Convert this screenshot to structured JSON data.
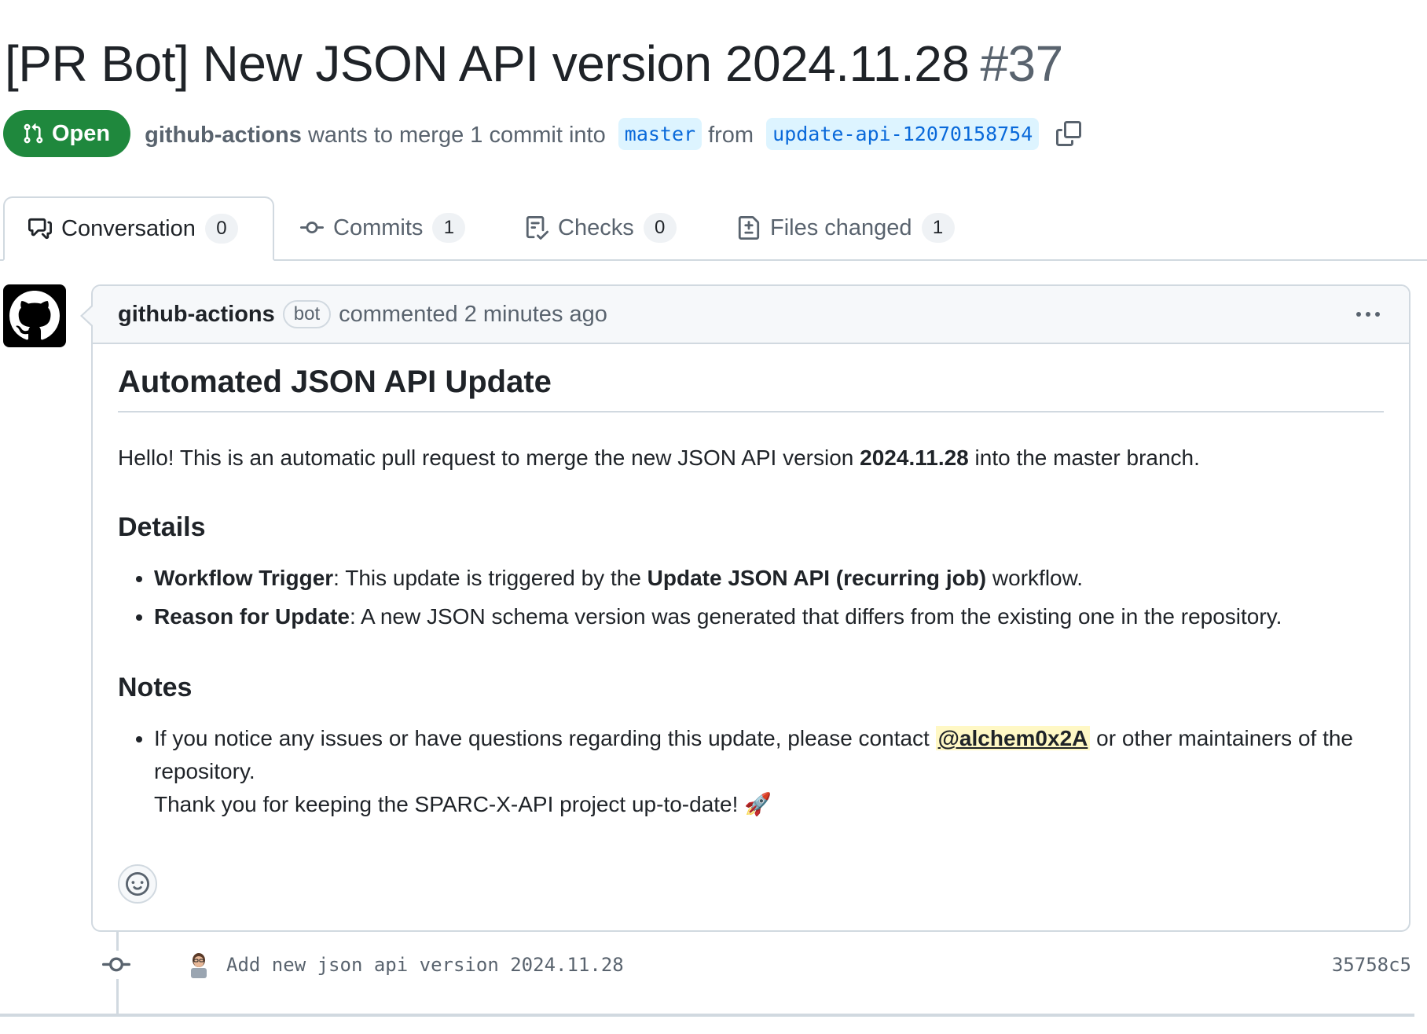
{
  "pr": {
    "title": "[PR Bot] New JSON API version 2024.11.28",
    "number": "#37",
    "state": "Open",
    "author": "github-actions",
    "merge_text": "wants to merge 1 commit into",
    "base_branch": "master",
    "from_text": "from",
    "head_branch": "update-api-12070158754"
  },
  "tabs": [
    {
      "label": "Conversation",
      "count": "0",
      "icon": "comment-discussion-icon"
    },
    {
      "label": "Commits",
      "count": "1",
      "icon": "git-commit-icon"
    },
    {
      "label": "Checks",
      "count": "0",
      "icon": "checklist-icon"
    },
    {
      "label": "Files changed",
      "count": "1",
      "icon": "file-diff-icon"
    }
  ],
  "comment": {
    "author": "github-actions",
    "badge": "bot",
    "meta": "commented 2 minutes ago",
    "heading": "Automated JSON API Update",
    "intro_pre": "Hello! This is an automatic pull request to merge the new JSON API version ",
    "intro_version": "2024.11.28",
    "intro_post": " into the master branch.",
    "details_heading": "Details",
    "details": [
      {
        "term": "Workflow Trigger",
        "pre": ": This update is triggered by the ",
        "strong": "Update JSON API (recurring job)",
        "post": " workflow."
      },
      {
        "term": "Reason for Update",
        "pre": ": A new JSON schema version was generated that differs from the existing one in the repository.",
        "strong": "",
        "post": ""
      }
    ],
    "notes_heading": "Notes",
    "notes_pre": "If you notice any issues or have questions regarding this update, please contact ",
    "notes_mention": "@alchem0x2A",
    "notes_post": " or other maintainers of the repository.",
    "notes_thanks": "Thank you for keeping the SPARC-X-API project up-to-date! 🚀"
  },
  "commit": {
    "message": "Add new json api version 2024.11.28",
    "sha": "35758c5"
  },
  "colors": {
    "open_green": "#1f883d",
    "branch_blue": "#0969da",
    "branch_bg": "#ddf4ff",
    "mention_bg": "#fff8c5",
    "border": "#d1d9e0"
  }
}
